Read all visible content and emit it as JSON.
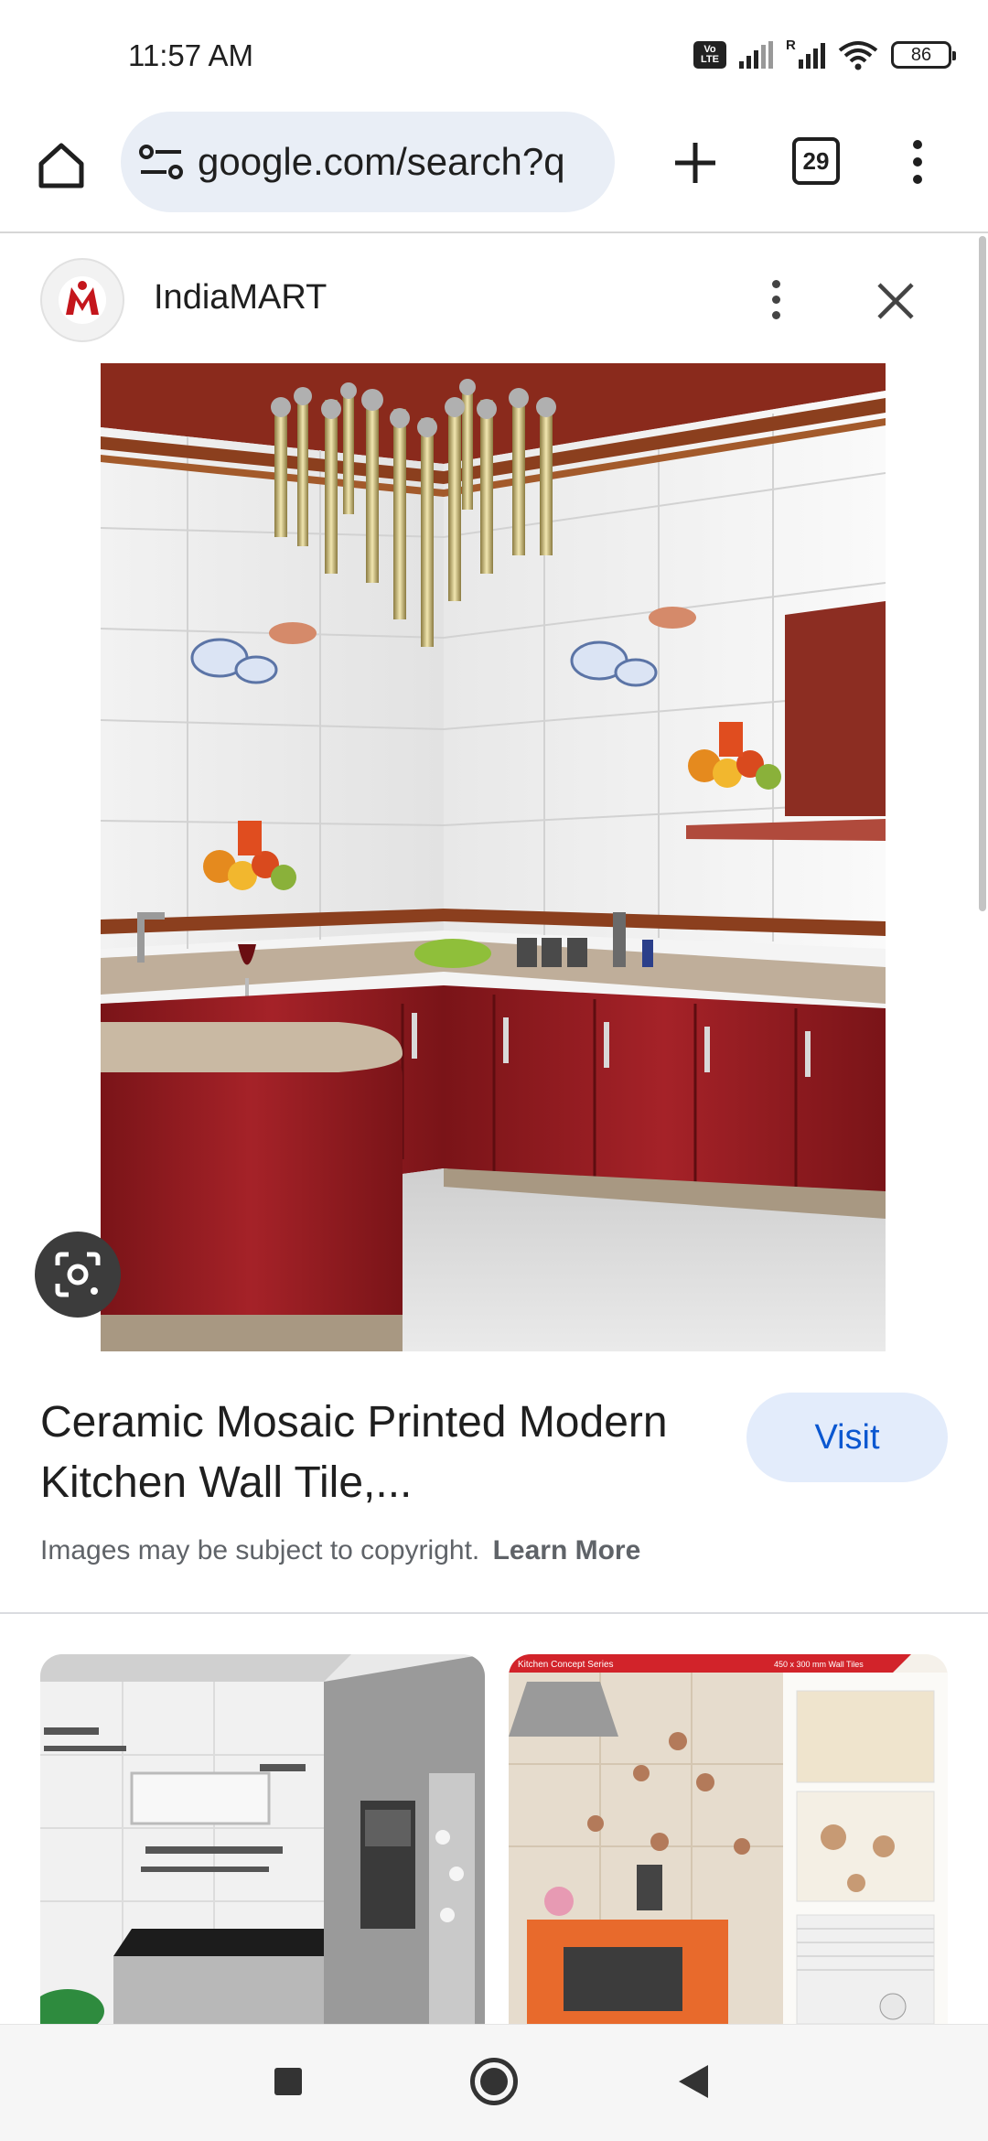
{
  "status_bar": {
    "time": "11:57 AM",
    "volte_line1": "Vo",
    "volte_line2": "LTE",
    "roaming_label": "R",
    "battery": "86"
  },
  "toolbar": {
    "url": "google.com/search?q",
    "tab_count": "29",
    "icons": [
      "home-icon",
      "site-settings-icon",
      "plus-icon",
      "kebab-menu-icon"
    ]
  },
  "source": {
    "name": "IndiaMART",
    "logo_letter": "M"
  },
  "result": {
    "title": "Ceramic Mosaic Printed Modern Kitchen Wall Tile,...",
    "visit_label": "Visit",
    "copyright_text": "Images may be subject to copyright.",
    "learn_more": "Learn More"
  },
  "related": {
    "thumb2_banner": "Kitchen Concept Series",
    "thumb2_size": "450 x 300 mm Wall Tiles"
  },
  "colors": {
    "omnibox_bg": "#e9eef6",
    "visit_bg": "#e3ecfb",
    "visit_text": "#0b57d0",
    "cabinet_red": "#8e1a1f",
    "logo_red": "#c4161c"
  }
}
